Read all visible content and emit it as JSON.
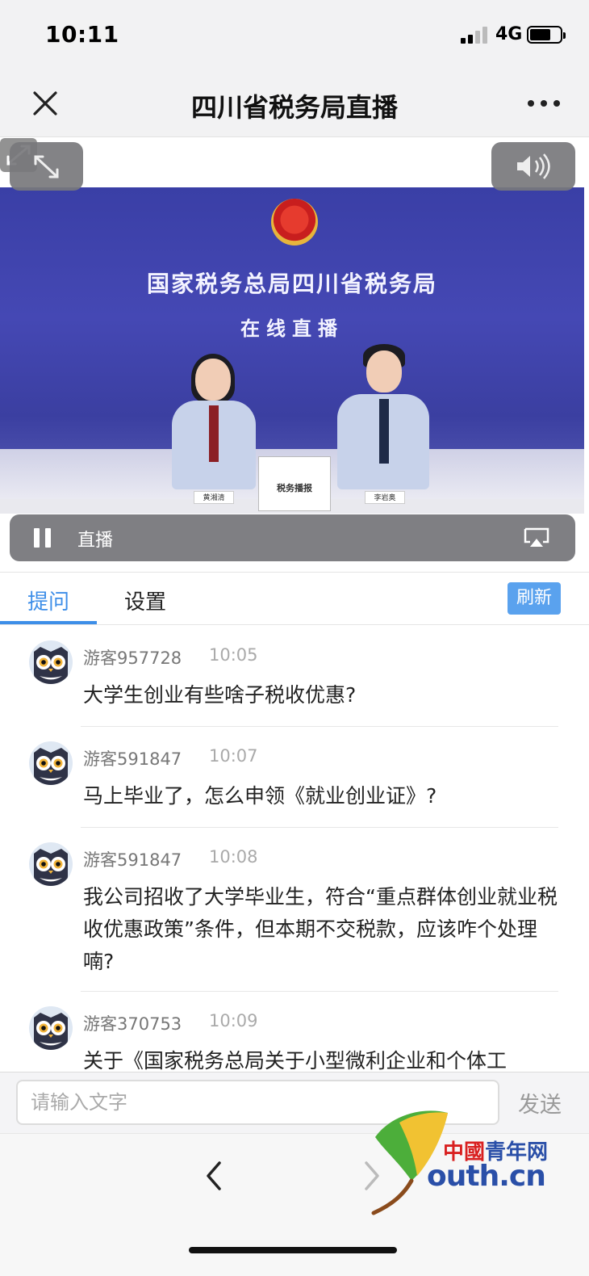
{
  "status_bar": {
    "time": "10:11",
    "network": "4G"
  },
  "title_bar": {
    "title": "四川省税务局直播"
  },
  "video": {
    "heading": "国家税务总局四川省税务局",
    "subheading": "在线直播",
    "center_sign": "税务播报",
    "nameplate_left": "黄湘清",
    "nameplate_right": "李岩奥"
  },
  "player": {
    "live_label": "直播"
  },
  "tabs": {
    "ask": "提问",
    "settings": "设置",
    "refresh": "刷新"
  },
  "messages": [
    {
      "user": "游客957728",
      "time": "10:05",
      "text": "大学生创业有些啥子税收优惠?"
    },
    {
      "user": "游客591847",
      "time": "10:07",
      "text": "马上毕业了，怎么申领《就业创业证》?"
    },
    {
      "user": "游客591847",
      "time": "10:08",
      "text": "我公司招收了大学毕业生，符合“重点群体创业就业税收优惠政策”条件，但本期不交税款，应该咋个处理喃?"
    },
    {
      "user": "游客370753",
      "time": "10:09",
      "text": "关于《国家税务总局关于小型微利企业和个体工"
    }
  ],
  "input_bar": {
    "placeholder": "请输入文字",
    "send": "发送"
  },
  "watermark": {
    "cn_prefix": "中國",
    "cn_suffix": "青年网",
    "domain": "outh.cn"
  }
}
